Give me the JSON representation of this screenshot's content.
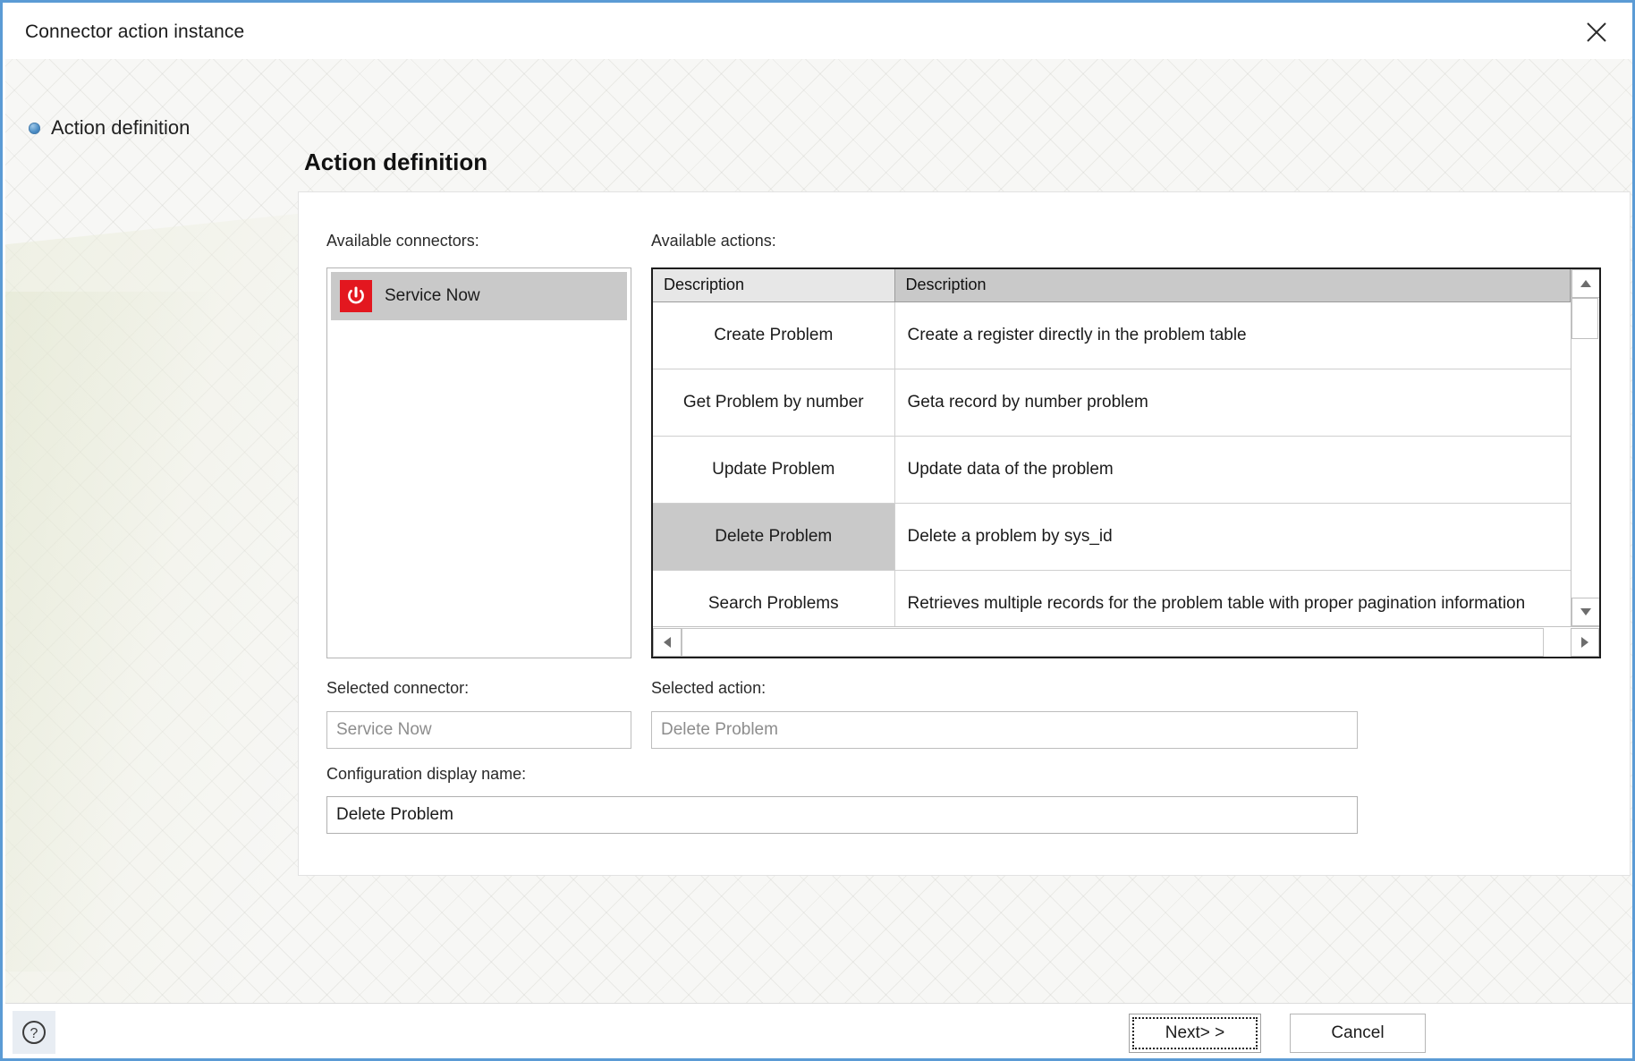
{
  "window": {
    "title": "Connector action instance",
    "close_icon": "close-icon"
  },
  "nav": {
    "items": [
      {
        "label": "Action definition",
        "bullet_icon": "bullet-icon",
        "selected": true
      }
    ]
  },
  "page": {
    "heading": "Action definition"
  },
  "connectors": {
    "label": "Available connectors:",
    "items": [
      {
        "name": "Service Now",
        "icon": "power-icon",
        "icon_color": "#e3171f",
        "selected": true
      }
    ]
  },
  "actions": {
    "label": "Available actions:",
    "columns": [
      "Description",
      "Description"
    ],
    "rows": [
      {
        "name": "Create Problem",
        "description": "Create a register directly in the problem table",
        "selected": false
      },
      {
        "name": "Get Problem by number",
        "description": "Geta record by number problem",
        "selected": false
      },
      {
        "name": "Update Problem",
        "description": "Update data of the problem",
        "selected": false
      },
      {
        "name": "Delete Problem",
        "description": "Delete a problem by sys_id",
        "selected": true
      },
      {
        "name": "Search Problems",
        "description": "Retrieves multiple records for the problem table with proper pagination information",
        "selected": false
      }
    ],
    "scrollbar": {
      "up_icon": "scroll-up-icon",
      "down_icon": "scroll-down-icon",
      "left_icon": "scroll-left-icon",
      "right_icon": "scroll-right-icon"
    }
  },
  "fields": {
    "selected_connector": {
      "label": "Selected connector:",
      "value": "Service Now",
      "readonly": true
    },
    "selected_action": {
      "label": "Selected action:",
      "value": "Delete Problem",
      "readonly": true
    },
    "configuration_display_name": {
      "label": "Configuration display name:",
      "value": "Delete Problem",
      "readonly": false
    }
  },
  "footer": {
    "help_icon": "help-icon",
    "next_label": "Next> >",
    "cancel_label": "Cancel"
  },
  "colors": {
    "window_border": "#5b9bd5",
    "selection": "#c9c9c9",
    "brand_red": "#e3171f"
  }
}
